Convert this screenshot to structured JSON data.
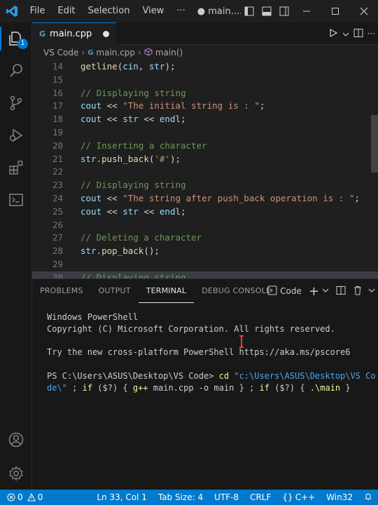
{
  "titlebar": {
    "menus": [
      "File",
      "Edit",
      "Selection",
      "View"
    ],
    "more": "···",
    "title": "● main...."
  },
  "activity": {
    "explorer_badge": "1"
  },
  "tab": {
    "filename": "main.cpp",
    "lang_icon": "G"
  },
  "breadcrumb": {
    "folder": "VS Code",
    "file": "main.cpp",
    "symbol": "main()"
  },
  "editor": {
    "lines": [
      {
        "n": "14",
        "html": "getline(cin, str);"
      },
      {
        "n": "15",
        "html": ""
      },
      {
        "n": "16",
        "html": "// Displaying string"
      },
      {
        "n": "17",
        "html": "cout << \"The initial string is : \";"
      },
      {
        "n": "18",
        "html": "cout << str << endl;"
      },
      {
        "n": "19",
        "html": ""
      },
      {
        "n": "20",
        "html": "// Inserting a character"
      },
      {
        "n": "21",
        "html": "str.push_back('#');"
      },
      {
        "n": "22",
        "html": ""
      },
      {
        "n": "23",
        "html": "// Displaying string"
      },
      {
        "n": "24",
        "html": "cout << \"The string after push_back operation is : \";"
      },
      {
        "n": "25",
        "html": "cout << str << endl;"
      },
      {
        "n": "26",
        "html": ""
      },
      {
        "n": "27",
        "html": "// Deleting a character"
      },
      {
        "n": "28",
        "html": "str.pop_back();"
      },
      {
        "n": "29",
        "html": ""
      },
      {
        "n": "30",
        "html": "// Displaying string"
      }
    ]
  },
  "panel": {
    "tabs": [
      "PROBLEMS",
      "OUTPUT",
      "TERMINAL",
      "DEBUG CONSOLE"
    ],
    "active_tab": "TERMINAL",
    "terminal_name": "Code",
    "terminal": {
      "l1": "Windows PowerShell",
      "l2": "Copyright (C) Microsoft Corporation. All rights reserved.",
      "l3": "Try the new cross-platform PowerShell https://aka.ms/pscore6",
      "prompt": "PS C:\\Users\\ASUS\\Desktop\\VS Code> ",
      "cmd_cd": "cd",
      "path_a": "\"c:\\Users\\ASUS\\Desktop\\VS Co",
      "path_b": "de\\\"",
      "rest_1": " ; ",
      "if1": "if",
      "cond1": " ($?) ",
      "brace1": "{ ",
      "gpp": "g++",
      "gpp_args": " main.cpp -o main ",
      "brace2": "}",
      "rest_2": " ; ",
      "if2": "if",
      "cond2": " ($?) ",
      "brace3": "{ ",
      "run": ".\\main",
      "brace4": " }"
    }
  },
  "statusbar": {
    "errors": "0",
    "warnings": "0",
    "position": "Ln 33, Col 1",
    "tab_size": "Tab Size: 4",
    "encoding": "UTF-8",
    "eol": "CRLF",
    "language": "C++",
    "platform": "Win32"
  },
  "colors": {
    "accent": "#0078d4",
    "status": "#007acc"
  }
}
